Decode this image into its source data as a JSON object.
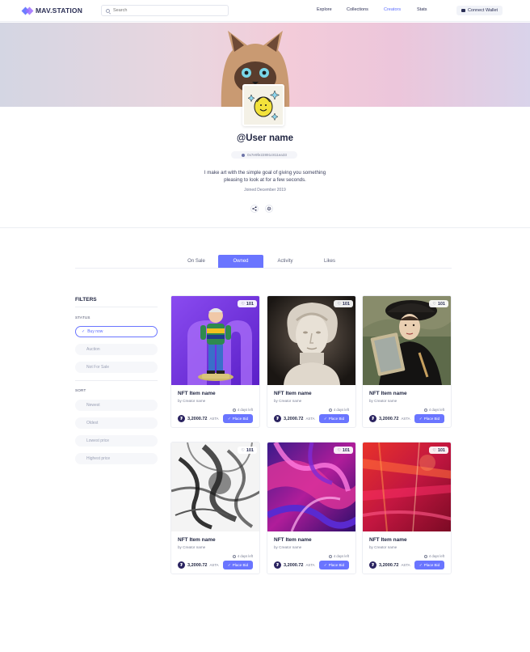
{
  "header": {
    "logo_text": "MAV.STATION",
    "search_placeholder": "Search",
    "nav": [
      {
        "label": "Explore"
      },
      {
        "label": "Collections"
      },
      {
        "label": "Creators"
      },
      {
        "label": "Stats"
      }
    ],
    "active_nav": "Creators",
    "connect_label": "Connect Wallet"
  },
  "profile": {
    "username": "@User name",
    "address": "0x7e9fe22891c811ea33",
    "bio_line1": "I make art with the simple goal of giving you something",
    "bio_line2": "pleasing to look at for a few seconds.",
    "joined": "Joined December 2019",
    "share_icon": "share-icon",
    "settings_icon": "gear-icon"
  },
  "tabs": [
    {
      "label": "On Sale"
    },
    {
      "label": "Owned"
    },
    {
      "label": "Activity"
    },
    {
      "label": "Likes"
    }
  ],
  "active_tab": "Owned",
  "filters": {
    "title": "FILTERS",
    "status_label": "STATUS",
    "status_options": [
      {
        "label": "Buy now",
        "selected": true
      },
      {
        "label": "Auction",
        "selected": false
      },
      {
        "label": "Not For Sale",
        "selected": false
      }
    ],
    "sort_label": "SORT",
    "sort_options": [
      {
        "label": "Newest"
      },
      {
        "label": "Oldest"
      },
      {
        "label": "Lowest price"
      },
      {
        "label": "Highest price"
      }
    ]
  },
  "cards": [
    {
      "likes": "101",
      "name": "NFT Item name",
      "creator": "by Creator name",
      "days_left": "4 days left",
      "price": "3,2000.72",
      "unit": "ASTA",
      "bid_label": "Place Bid",
      "image": "figure"
    },
    {
      "likes": "101",
      "name": "NFT Item name",
      "creator": "by Creator name",
      "days_left": "4 days left",
      "price": "3,2000.72",
      "unit": "ASTA",
      "bid_label": "Place Bid",
      "image": "statue"
    },
    {
      "likes": "101",
      "name": "NFT Item name",
      "creator": "by Creator name",
      "days_left": "4 days left",
      "price": "3,2000.72",
      "unit": "ASTA",
      "bid_label": "Place Bid",
      "image": "painting"
    },
    {
      "likes": "101",
      "name": "NFT Item name",
      "creator": "by Creator name",
      "days_left": "4 days left",
      "price": "3,2000.72",
      "unit": "ASTA",
      "bid_label": "Place Bid",
      "image": "ink"
    },
    {
      "likes": "101",
      "name": "NFT Item name",
      "creator": "by Creator name",
      "days_left": "4 days left",
      "price": "3,2000.72",
      "unit": "ASTA",
      "bid_label": "Place Bid",
      "image": "fluid"
    },
    {
      "likes": "101",
      "name": "NFT Item name",
      "creator": "by Creator name",
      "days_left": "4 days left",
      "price": "3,2000.72",
      "unit": "ASTA",
      "bid_label": "Place Bid",
      "image": "red-abstract"
    }
  ],
  "colors": {
    "accent": "#6a75ff",
    "text": "#1f2440",
    "muted": "#7b8096"
  }
}
